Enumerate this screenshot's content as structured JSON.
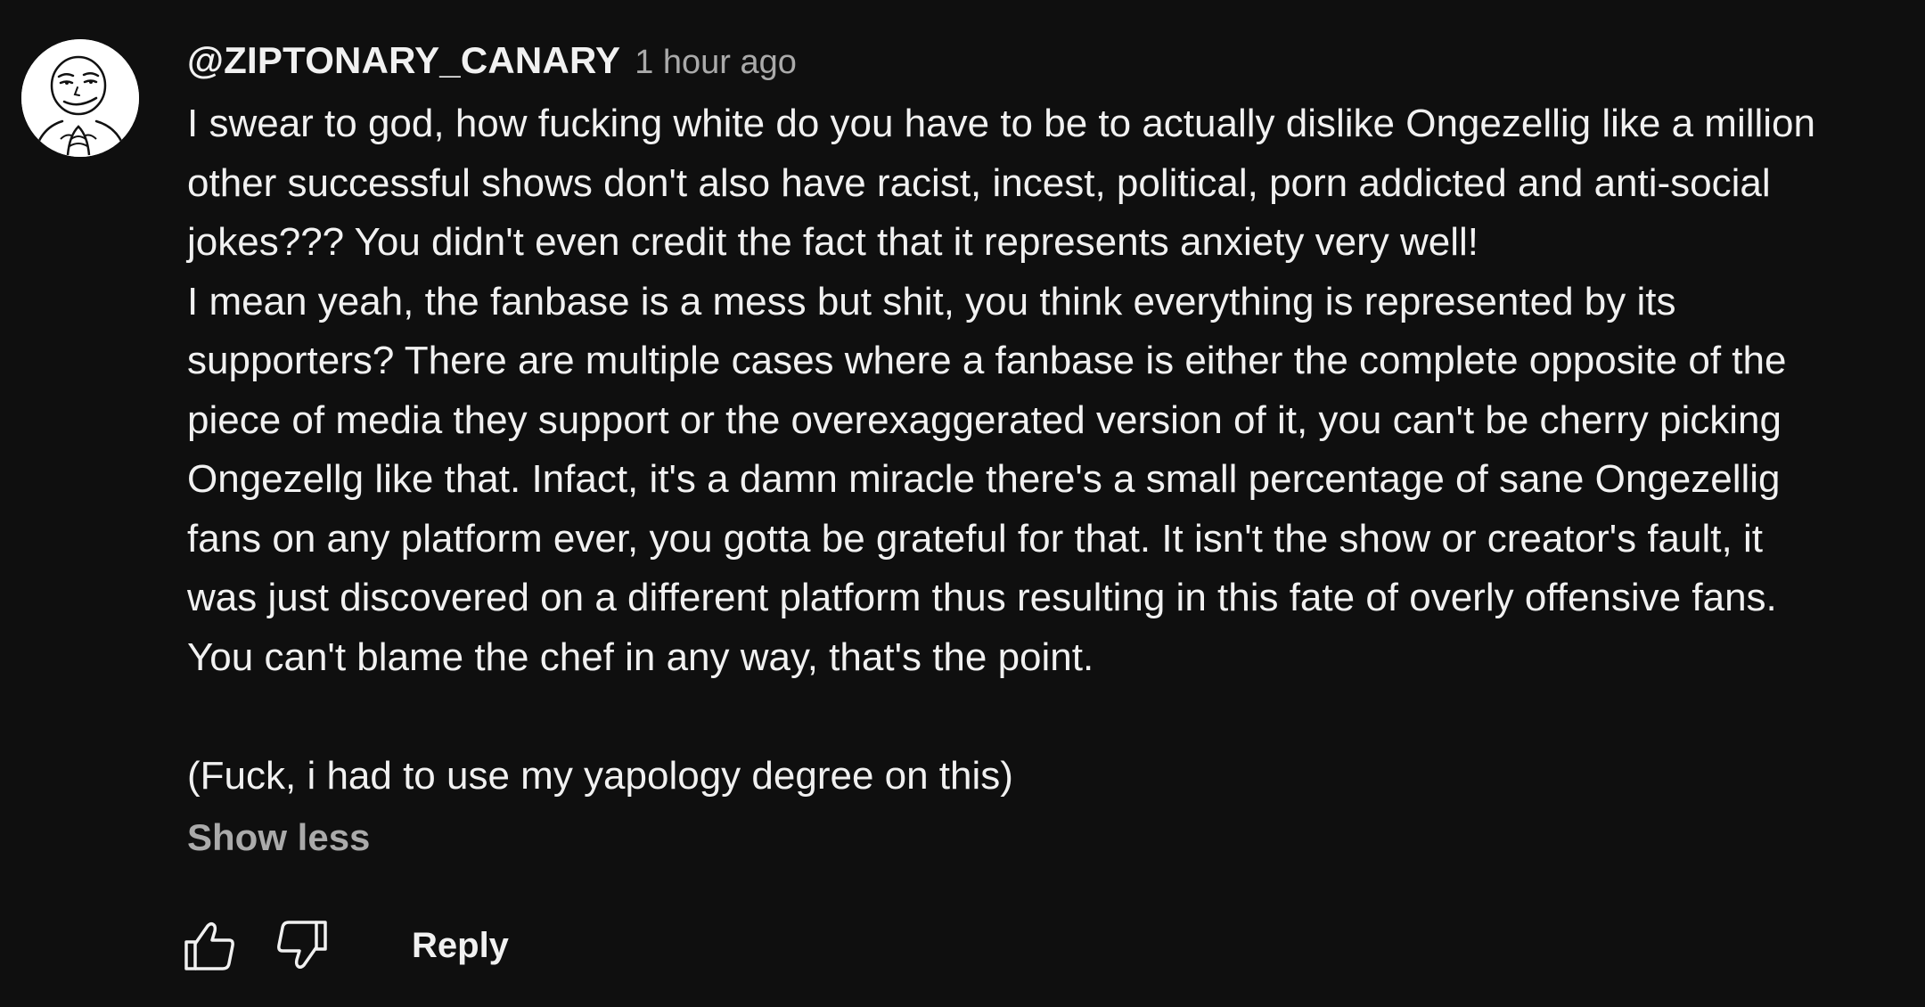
{
  "comment": {
    "author": "@ZIPTONARY_CANARY",
    "timestamp": "1 hour ago",
    "avatar_icon": "smirking-meme-face-icon",
    "lines": [
      "I swear to god, how fucking white do you have to be to actually dislike Ongezellig like a million",
      "other successful shows don't also have racist, incest, political, porn addicted and anti-social",
      "jokes??? You didn't even credit the fact that it represents anxiety very well!",
      "I mean yeah, the fanbase is a mess but shit, you think everything is represented by its",
      "supporters? There are multiple cases where a fanbase is either the complete opposite of the",
      "piece of media they support or the overexaggerated version of it, you can't be cherry picking",
      "Ongezellg like that. Infact, it's a damn miracle there's a small percentage of sane Ongezellig",
      "fans on any platform ever, you gotta be grateful for that. It isn't the show or creator's fault, it",
      "was just discovered on a different platform thus resulting in this fate of overly offensive fans.",
      "You can't blame the chef in any way, that's the point."
    ],
    "final_line": "(Fuck, i had to use my yapology degree on this)",
    "show_less_label": "Show less"
  },
  "actions": {
    "like_icon": "thumbs-up-icon",
    "dislike_icon": "thumbs-down-icon",
    "reply_label": "Reply"
  },
  "colors": {
    "background": "#0f0f0f",
    "text_primary": "#f1f1f1",
    "text_secondary": "#aaaaaa"
  }
}
